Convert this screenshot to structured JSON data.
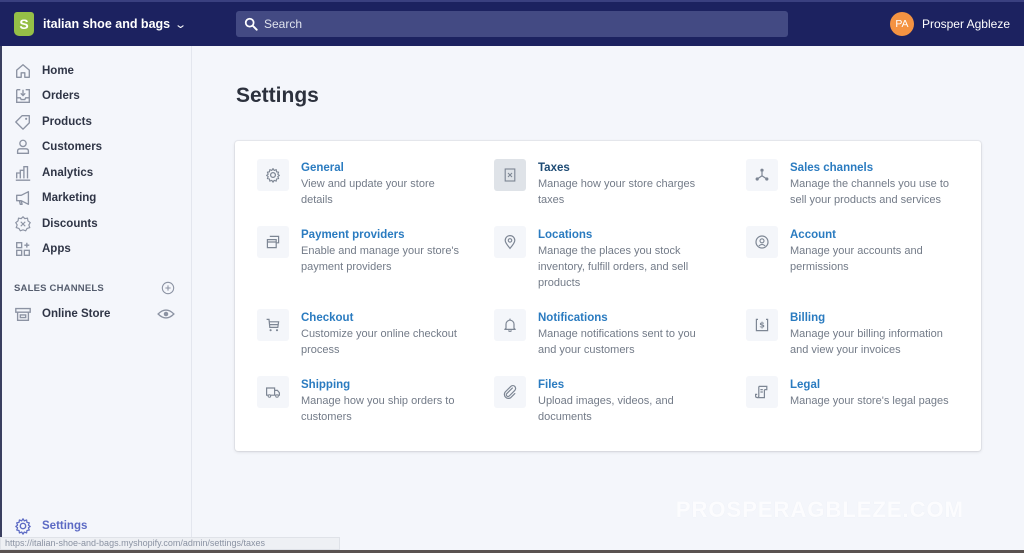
{
  "topbar": {
    "store_name": "italian shoe and bags",
    "logo_letter": "S",
    "search_placeholder": "Search",
    "user_initials": "PA",
    "user_name": "Prosper Agbleze",
    "colors": {
      "bar": "#1c2260",
      "search": "#434a83",
      "avatar": "#f49342",
      "logo": "#95bf47"
    }
  },
  "sidebar": {
    "items": [
      {
        "label": "Home",
        "icon": "home-icon"
      },
      {
        "label": "Orders",
        "icon": "orders-icon"
      },
      {
        "label": "Products",
        "icon": "tag-icon"
      },
      {
        "label": "Customers",
        "icon": "person-icon"
      },
      {
        "label": "Analytics",
        "icon": "bar-chart-icon"
      },
      {
        "label": "Marketing",
        "icon": "megaphone-icon"
      },
      {
        "label": "Discounts",
        "icon": "discount-icon"
      },
      {
        "label": "Apps",
        "icon": "apps-icon"
      }
    ],
    "sales_channels_label": "SALES CHANNELS",
    "online_store_label": "Online Store",
    "settings_label": "Settings"
  },
  "status_url": "https://italian-shoe-and-bags.myshopify.com/admin/settings/taxes",
  "main": {
    "title": "Settings",
    "link_color": "#2a7bc0",
    "items": [
      {
        "title": "General",
        "desc": "View and update your store details",
        "icon": "gear-icon"
      },
      {
        "title": "Taxes",
        "desc": "Manage how your store charges taxes",
        "icon": "taxes-icon",
        "hovered": true
      },
      {
        "title": "Sales channels",
        "desc": "Manage the channels you use to sell your products and services",
        "icon": "sales-channels-icon"
      },
      {
        "title": "Payment providers",
        "desc": "Enable and manage your store's payment providers",
        "icon": "payment-icon"
      },
      {
        "title": "Locations",
        "desc": "Manage the places you stock inventory, fulfill orders, and sell products",
        "icon": "location-pin-icon"
      },
      {
        "title": "Account",
        "desc": "Manage your accounts and permissions",
        "icon": "account-icon"
      },
      {
        "title": "Checkout",
        "desc": "Customize your online checkout process",
        "icon": "cart-icon"
      },
      {
        "title": "Notifications",
        "desc": "Manage notifications sent to you and your customers",
        "icon": "bell-icon"
      },
      {
        "title": "Billing",
        "desc": "Manage your billing information and view your invoices",
        "icon": "billing-icon"
      },
      {
        "title": "Shipping",
        "desc": "Manage how you ship orders to customers",
        "icon": "truck-icon"
      },
      {
        "title": "Files",
        "desc": "Upload images, videos, and documents",
        "icon": "paperclip-icon"
      },
      {
        "title": "Legal",
        "desc": "Manage your store's legal pages",
        "icon": "legal-icon"
      }
    ]
  },
  "watermark": "PROSPERAGBLEZE.COM"
}
